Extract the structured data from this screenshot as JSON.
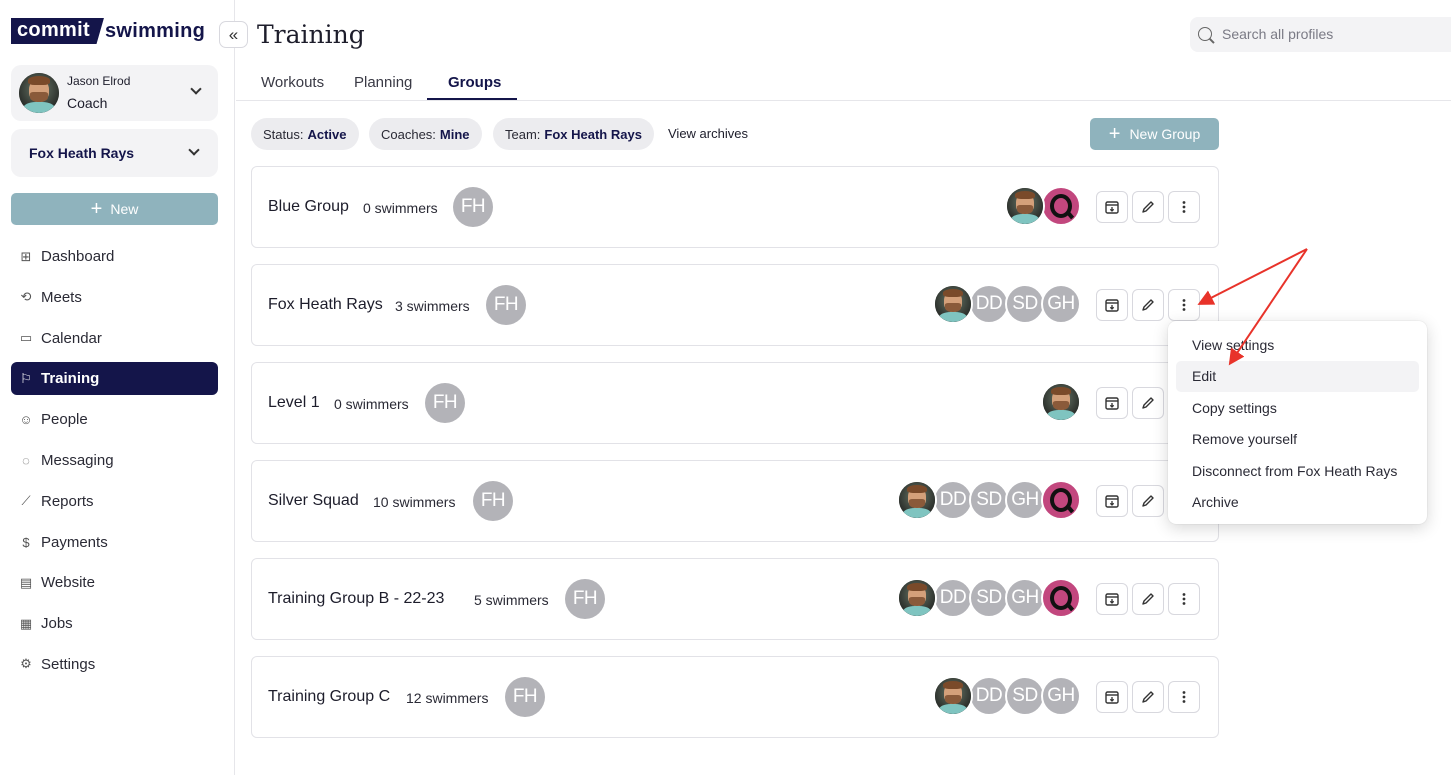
{
  "app": {
    "logo_left": "commit",
    "logo_right": "swimming",
    "collapse_icon": "«"
  },
  "user": {
    "name": "Jason Elrod",
    "role": "Coach"
  },
  "team_selector": {
    "name": "Fox Heath Rays"
  },
  "sidebar": {
    "new_label": "New",
    "items": [
      {
        "label": "Dashboard",
        "icon": "grid-icon",
        "glyph": "⊞"
      },
      {
        "label": "Meets",
        "icon": "meets-icon",
        "glyph": "⟲"
      },
      {
        "label": "Calendar",
        "icon": "calendar-icon",
        "glyph": "▭"
      },
      {
        "label": "Training",
        "icon": "training-icon",
        "glyph": "⚐",
        "active": true
      },
      {
        "label": "People",
        "icon": "people-icon",
        "glyph": "☺"
      },
      {
        "label": "Messaging",
        "icon": "messaging-icon",
        "glyph": "◌"
      },
      {
        "label": "Reports",
        "icon": "reports-icon",
        "glyph": "⟋"
      },
      {
        "label": "Payments",
        "icon": "payments-icon",
        "glyph": "$"
      },
      {
        "label": "Website",
        "icon": "website-icon",
        "glyph": "▤"
      },
      {
        "label": "Jobs",
        "icon": "jobs-icon",
        "glyph": "▦"
      },
      {
        "label": "Settings",
        "icon": "settings-icon",
        "glyph": "⚙"
      }
    ]
  },
  "header": {
    "title": "Training",
    "search_placeholder": "Search all profiles"
  },
  "tabs": [
    {
      "label": "Workouts"
    },
    {
      "label": "Planning"
    },
    {
      "label": "Groups",
      "active": true
    }
  ],
  "filters": [
    {
      "key": "Status:",
      "value": "Active"
    },
    {
      "key": "Coaches:",
      "value": "Mine"
    },
    {
      "key": "Team:",
      "value": "Fox Heath Rays"
    }
  ],
  "view_archives_label": "View archives",
  "new_group_label": "New Group",
  "team_badge": "FH",
  "groups": [
    {
      "name": "Blue Group",
      "count": "0 swimmers",
      "coaches": [
        "photo",
        "q"
      ]
    },
    {
      "name": "Fox Heath Rays",
      "count": "3 swimmers",
      "coaches": [
        "photo",
        "DD",
        "SD",
        "GH"
      ]
    },
    {
      "name": "Level 1",
      "count": "0 swimmers",
      "coaches": [
        "photo"
      ]
    },
    {
      "name": "Silver Squad",
      "count": "10 swimmers",
      "coaches": [
        "photo",
        "DD",
        "SD",
        "GH",
        "q"
      ]
    },
    {
      "name": "Training Group B - 22-23",
      "count": "5 swimmers",
      "coaches": [
        "photo",
        "DD",
        "SD",
        "GH",
        "q"
      ]
    },
    {
      "name": "Training Group C",
      "count": "12 swimmers",
      "coaches": [
        "photo",
        "DD",
        "SD",
        "GH"
      ]
    }
  ],
  "menu": {
    "items": [
      "View settings",
      "Edit",
      "Copy settings",
      "Remove yourself",
      "Disconnect from Fox Heath Rays",
      "Archive"
    ],
    "hovered": "Edit"
  },
  "colors": {
    "brand": "#14154a",
    "accent_button": "#8fb3bd",
    "annotation_arrow": "#e8332a"
  }
}
